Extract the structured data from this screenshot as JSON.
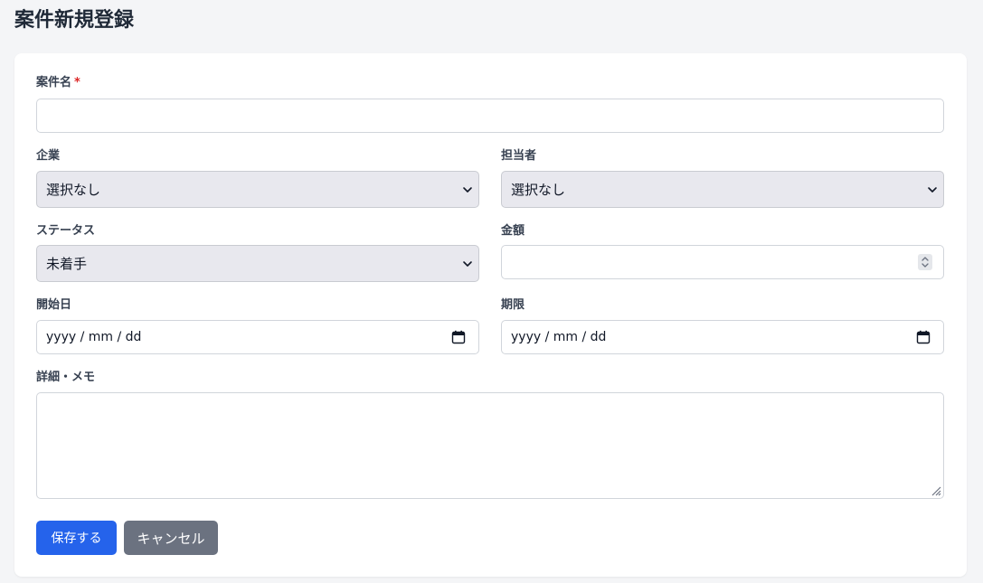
{
  "page": {
    "title": "案件新規登録"
  },
  "form": {
    "name": {
      "label": "案件名",
      "required_mark": "*",
      "value": ""
    },
    "company": {
      "label": "企業",
      "selected": "選択なし"
    },
    "assignee": {
      "label": "担当者",
      "selected": "選択なし"
    },
    "status": {
      "label": "ステータス",
      "selected": "未着手"
    },
    "amount": {
      "label": "金額",
      "value": ""
    },
    "start_date": {
      "label": "開始日",
      "placeholder": "yyyy / mm / dd"
    },
    "due_date": {
      "label": "期限",
      "placeholder": "yyyy / mm / dd"
    },
    "memo": {
      "label": "詳細・メモ",
      "value": ""
    }
  },
  "actions": {
    "save_label": "保存する",
    "cancel_label": "キャンセル"
  },
  "colors": {
    "primary": "#2563eb",
    "secondary": "#6b7280",
    "required": "#dc2626",
    "select_bg": "#e8e8ee",
    "page_bg": "#f4f5f7"
  }
}
